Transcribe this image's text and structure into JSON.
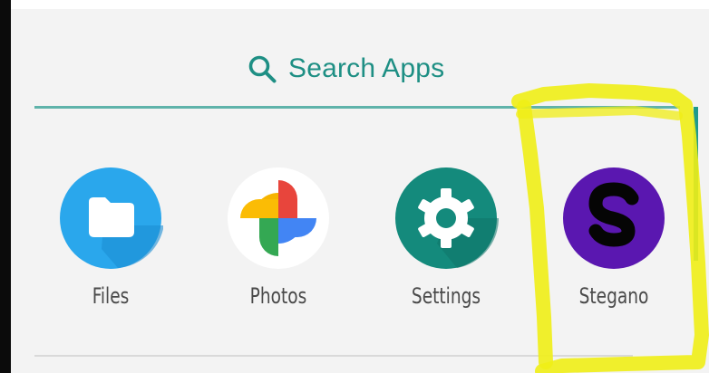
{
  "search": {
    "label": "Search Apps",
    "icon": "search-icon",
    "accent_color": "#1e8f84"
  },
  "apps": [
    {
      "label": "Files",
      "icon": "folder-icon",
      "color": "#2aa7ec"
    },
    {
      "label": "Photos",
      "icon": "pinwheel-icon",
      "color": "#ffffff"
    },
    {
      "label": "Settings",
      "icon": "gear-icon",
      "color": "#148a7c"
    },
    {
      "label": "Stegano",
      "icon": "letter-s-icon",
      "color": "#5a17b0"
    }
  ],
  "annotation": {
    "highlight_color": "#f0ee16"
  }
}
